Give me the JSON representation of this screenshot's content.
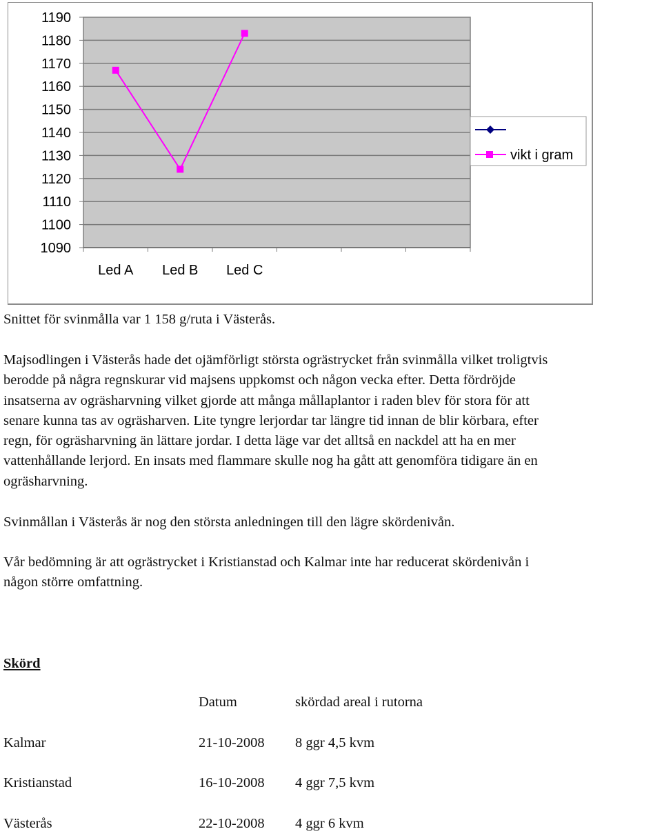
{
  "chart_data": {
    "type": "line",
    "title": "",
    "xlabel": "",
    "ylabel": "",
    "categories": [
      "Led A",
      "Led B",
      "Led C",
      "",
      "",
      ""
    ],
    "ylim": [
      1090,
      1190
    ],
    "yticks": [
      "1190",
      "1180",
      "1170",
      "1160",
      "1150",
      "1140",
      "1130",
      "1120",
      "1110",
      "1100",
      "1090"
    ],
    "grid": true,
    "legend_position": "right",
    "series": [
      {
        "name": "",
        "color": "#000080",
        "marker": "diamond",
        "values": []
      },
      {
        "name": "vikt i gram",
        "color": "#ff00ff",
        "marker": "square",
        "values": [
          1167,
          1124,
          1183
        ]
      }
    ],
    "plot_background": "#c0c0c0"
  },
  "document": {
    "caption": "Snittet för svinmålla var 1 158 g/ruta i Västerås.",
    "paragraph1": [
      "Majsodlingen i Västerås hade det ojämförligt största ogrästrycket från svinmålla vilket troligtvis",
      "berodde på några regnskurar vid majsens uppkomst och någon vecka efter. Detta fördröjde",
      "insatserna av ogräsharvning vilket gjorde att många mållaplantor i raden blev för stora för att",
      "senare kunna tas av ogräsharven. Lite tyngre lerjordar tar längre tid innan de blir körbara, efter",
      "regn, för ogräsharvning än lättare jordar. I detta läge var det alltså en nackdel att ha en mer",
      "vattenhållande lerjord. En insats med flammare skulle nog ha gått att genomföra tidigare än en",
      "ogräsharvning."
    ],
    "paragraph2": "Svinmållan i Västerås är nog den största anledningen till den lägre skördenivån.",
    "paragraph3": [
      "Vår bedömning är att ogrästrycket i Kristianstad och Kalmar inte har reducerat skördenivån i",
      "någon större omfattning."
    ],
    "section_heading": "Skörd",
    "harvest_table": {
      "headers": [
        "",
        "Datum",
        "skördad areal i rutorna"
      ],
      "rows": [
        [
          "Kalmar",
          "21-10-2008",
          "8 ggr 4,5 kvm"
        ],
        [
          "Kristianstad",
          "16-10-2008",
          "4 ggr 7,5 kvm"
        ],
        [
          "Västerås",
          "22-10-2008",
          "4 ggr 6 kvm"
        ]
      ]
    }
  }
}
